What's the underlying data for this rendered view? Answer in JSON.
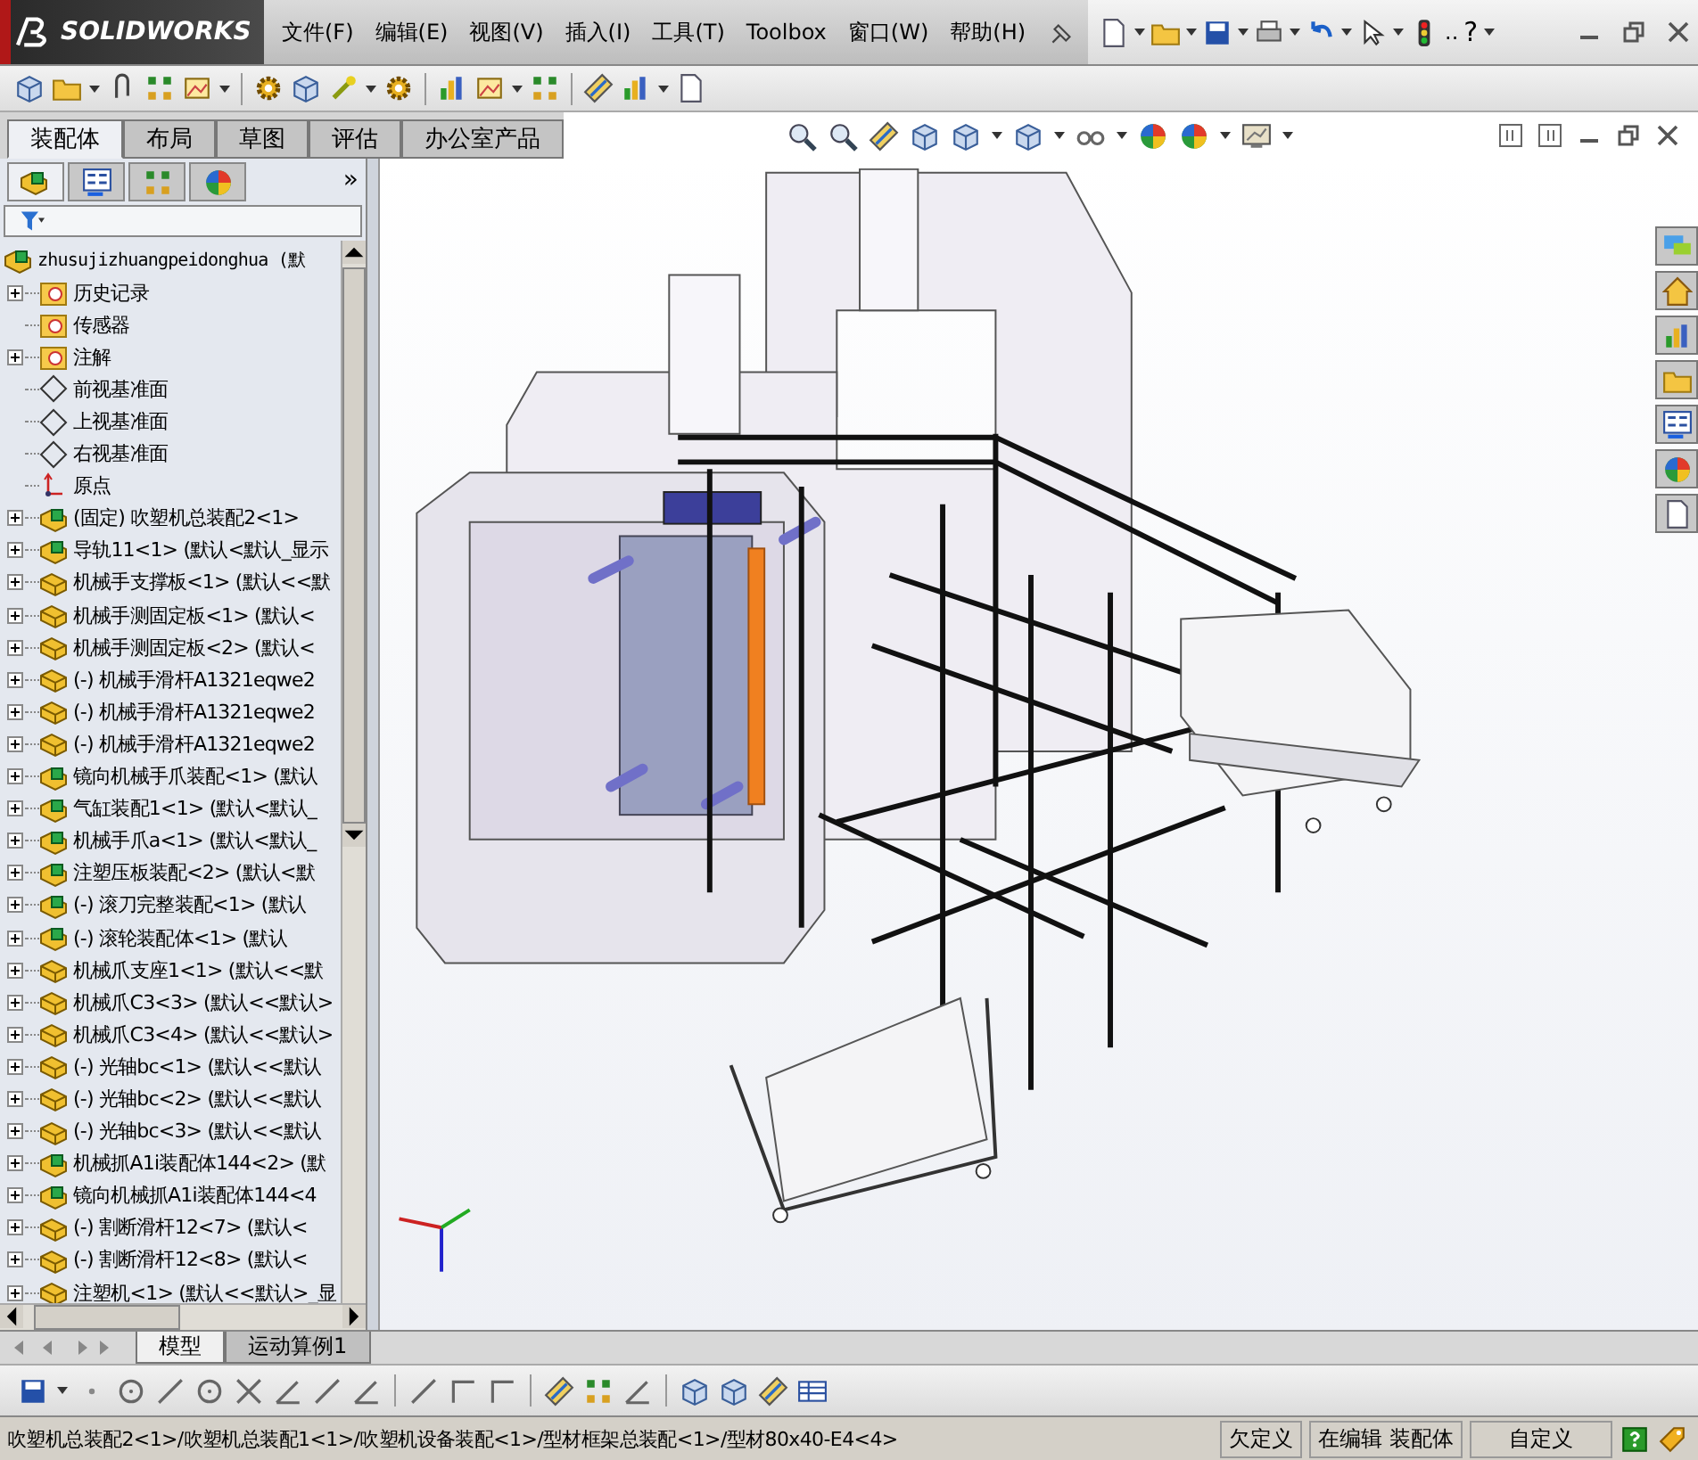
{
  "app": {
    "logo": "SOLIDWORKS"
  },
  "menu_bar": {
    "items": [
      {
        "label": "文件(F)"
      },
      {
        "label": "编辑(E)"
      },
      {
        "label": "视图(V)"
      },
      {
        "label": "插入(I)"
      },
      {
        "label": "工具(T)"
      },
      {
        "label": "Toolbox"
      },
      {
        "label": "窗口(W)"
      },
      {
        "label": "帮助(H)"
      }
    ],
    "overflow_mark": "..",
    "help_symbol": "?"
  },
  "command_tabs": [
    {
      "label": "装配体",
      "selected": true
    },
    {
      "label": "布局",
      "selected": false
    },
    {
      "label": "草图",
      "selected": false
    },
    {
      "label": "评估",
      "selected": false
    },
    {
      "label": "办公室产品",
      "selected": false
    }
  ],
  "feature_manager": {
    "more_symbol": "»",
    "tree": {
      "label": "zhusujizhuangpeidonghua  (默",
      "kind": "assembly",
      "children": [
        {
          "label": "历史记录",
          "kind": "folder",
          "expandable": true
        },
        {
          "label": "传感器",
          "kind": "folder",
          "expandable": false
        },
        {
          "label": "注解",
          "kind": "folder",
          "expandable": true
        },
        {
          "label": "前视基准面",
          "kind": "plane",
          "expandable": false
        },
        {
          "label": "上视基准面",
          "kind": "plane",
          "expandable": false
        },
        {
          "label": "右视基准面",
          "kind": "plane",
          "expandable": false
        },
        {
          "label": "原点",
          "kind": "origin",
          "expandable": false
        },
        {
          "label": "(固定) 吹塑机总装配2<1>",
          "kind": "assembly",
          "expandable": true
        },
        {
          "label": "导轨11<1> (默认<默认_显示",
          "kind": "assembly",
          "expandable": true
        },
        {
          "label": "机械手支撑板<1> (默认<<默",
          "kind": "part",
          "expandable": true
        },
        {
          "label": "机械手测固定板<1> (默认<",
          "kind": "part",
          "expandable": true
        },
        {
          "label": "机械手测固定板<2> (默认<",
          "kind": "part",
          "expandable": true
        },
        {
          "label": "(-) 机械手滑杆A1321eqwe2",
          "kind": "part",
          "expandable": true
        },
        {
          "label": "(-) 机械手滑杆A1321eqwe2",
          "kind": "part",
          "expandable": true
        },
        {
          "label": "(-) 机械手滑杆A1321eqwe2",
          "kind": "part",
          "expandable": true
        },
        {
          "label": "镜向机械手爪装配<1> (默认",
          "kind": "assembly",
          "expandable": true
        },
        {
          "label": "气缸装配1<1> (默认<默认_",
          "kind": "assembly",
          "expandable": true
        },
        {
          "label": "机械手爪a<1> (默认<默认_",
          "kind": "assembly",
          "expandable": true
        },
        {
          "label": "注塑压板装配<2> (默认<默",
          "kind": "assembly",
          "expandable": true
        },
        {
          "label": "(-) 滚刀完整装配<1> (默认",
          "kind": "assembly",
          "expandable": true
        },
        {
          "label": "(-) 滚轮装配体<1> (默认",
          "kind": "assembly",
          "expandable": true
        },
        {
          "label": "机械爪支座1<1> (默认<<默",
          "kind": "part",
          "expandable": true
        },
        {
          "label": "机械爪C3<3> (默认<<默认>",
          "kind": "part",
          "expandable": true
        },
        {
          "label": "机械爪C3<4> (默认<<默认>",
          "kind": "part",
          "expandable": true
        },
        {
          "label": "(-) 光轴bc<1> (默认<<默认",
          "kind": "part",
          "expandable": true
        },
        {
          "label": "(-) 光轴bc<2> (默认<<默认",
          "kind": "part",
          "expandable": true
        },
        {
          "label": "(-) 光轴bc<3> (默认<<默认",
          "kind": "part",
          "expandable": true
        },
        {
          "label": "机械抓A1i装配体144<2> (默",
          "kind": "assembly",
          "expandable": true
        },
        {
          "label": "镜向机械抓A1i装配体144<4",
          "kind": "assembly",
          "expandable": true
        },
        {
          "label": "(-) 割断滑杆12<7> (默认<",
          "kind": "part",
          "expandable": true
        },
        {
          "label": "(-) 割断滑杆12<8> (默认<",
          "kind": "part",
          "expandable": true
        },
        {
          "label": "注塑机<1> (默认<<默认>_显",
          "kind": "part",
          "expandable": true
        }
      ]
    }
  },
  "bottom_tabs": [
    {
      "label": "模型",
      "selected": true
    },
    {
      "label": "运动算例1",
      "selected": false
    }
  ],
  "status_bar": {
    "path": "吹塑机总装配2<1>/吹塑机总装配1<1>/吹塑机设备装配<1>/型材框架总装配<1>/型材80x40-E4<4>",
    "definition": "欠定义",
    "editing": "在编辑 装配体",
    "units": "自定义"
  }
}
